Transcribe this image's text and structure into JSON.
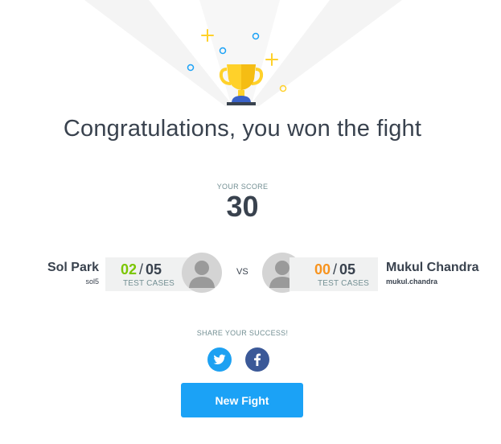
{
  "headline": "Congratulations, you won the fight",
  "score": {
    "label": "YOUR SCORE",
    "value": "30"
  },
  "player_left": {
    "name": "Sol Park",
    "handle": "sol5",
    "passed": "02",
    "total": "05",
    "cases_label": "TEST CASES",
    "passed_color": "#7bc600"
  },
  "versus": "VS",
  "player_right": {
    "name": "Mukul Chandra",
    "handle": "mukul.chandra",
    "passed": "00",
    "total": "05",
    "cases_label": "TEST CASES",
    "passed_color": "#f7931e"
  },
  "share": {
    "label": "SHARE YOUR SUCCESS!",
    "networks": [
      "twitter-icon",
      "facebook-icon"
    ]
  },
  "new_fight_button": "New Fight",
  "colors": {
    "text": "#39424e",
    "muted": "#738f93",
    "accent": "#1ba2f6",
    "trophy": "#ffd12a",
    "trophy_base": "#3a62c9"
  }
}
